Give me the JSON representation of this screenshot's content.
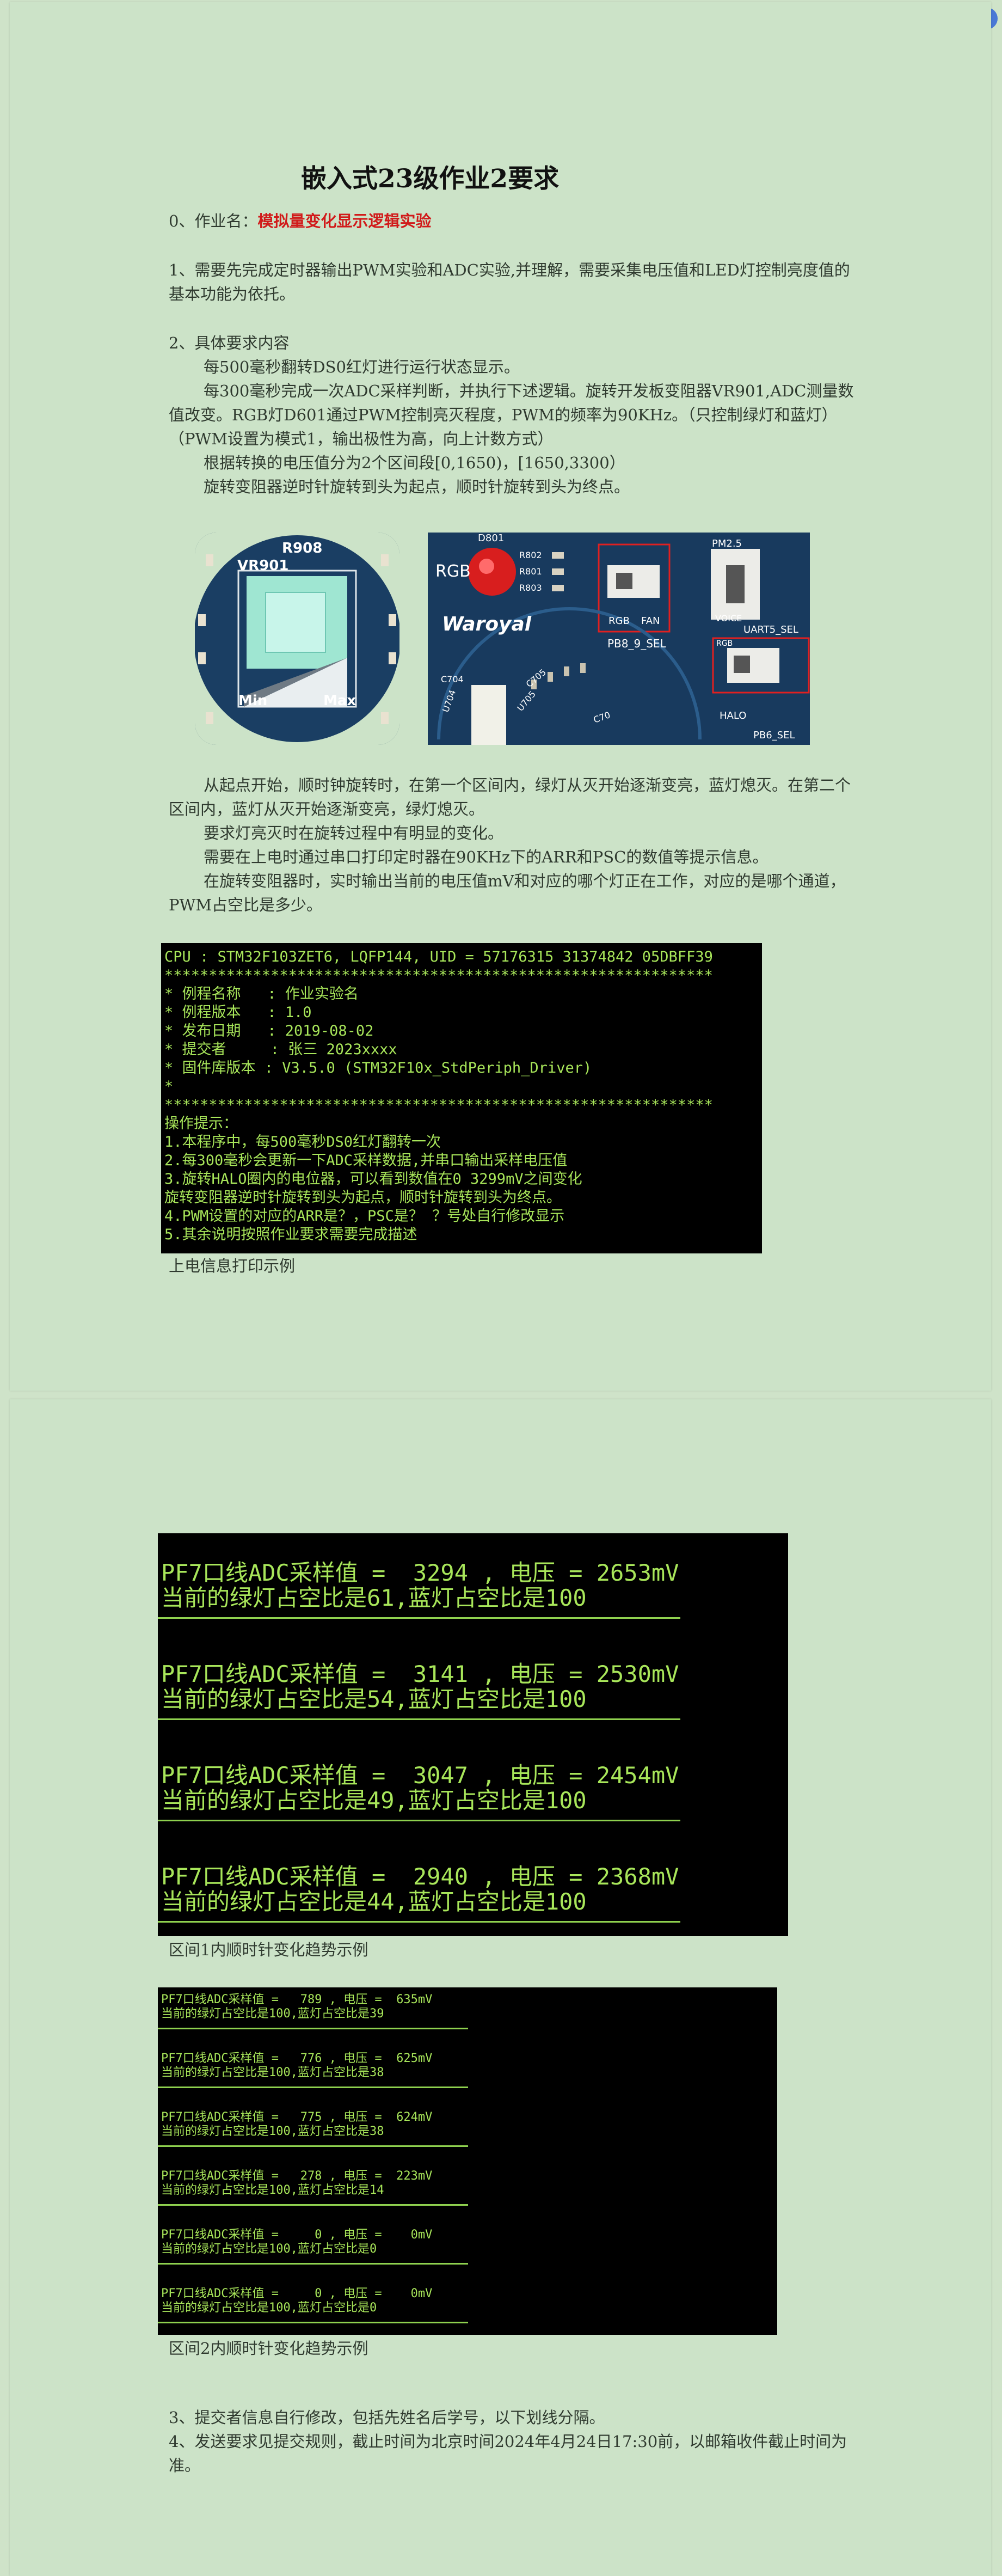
{
  "badge": "⚙",
  "title": "嵌入式23级作业2要求",
  "section0": {
    "prefix": "0、作业名：",
    "name": "模拟量变化显示逻辑实验"
  },
  "section1": "1、需要先完成定时器输出PWM实验和ADC实验,并理解，需要采集电压值和LED灯控制亮度值的基本功能为依托。",
  "section2": {
    "heading": "2、具体要求内容",
    "p1": "每500毫秒翻转DS0红灯进行运行状态显示。",
    "p2": "每300毫秒完成一次ADC采样判断，并执行下述逻辑。旋转开发板变阻器VR901,ADC测量数值改变。RGB灯D601通过PWM控制亮灭程度，PWM的频率为90KHz。（只控制绿灯和蓝灯）（PWM设置为模式1，输出极性为高，向上计数方式）",
    "p3": "根据转换的电压值分为2个区间段[0,1650)，[1650,3300）",
    "p4": "旋转变阻器逆时针旋转到头为起点，顺时针旋转到头为终点。",
    "p5": "从起点开始，顺时钟旋转时，在第一个区间内，绿灯从灭开始逐渐变亮，蓝灯熄灭。在第二个区间内，蓝灯从灭开始逐渐变亮，绿灯熄灭。",
    "p6": "要求灯亮灭时在旋转过程中有明显的变化。",
    "p7": "需要在上电时通过串口打印定时器在90KHz下的ARR和PSC的数值等提示信息。",
    "p8": "在旋转变阻器时，实时输出当前的电压值mV和对应的哪个灯正在工作，对应的是哪个通道，PWM占空比是多少。"
  },
  "board1": {
    "r": "R908",
    "vr": "VR901",
    "min": "Min",
    "max": "Max"
  },
  "board2": {
    "d801": "D801",
    "rgb": "RGB",
    "r802": "R802",
    "r801": "R801",
    "r803": "R803",
    "rgb2": "RGB",
    "fan": "FAN",
    "pb8": "PB8_9_SEL",
    "pm25": "PM2.5",
    "voice": "VOICE",
    "uart": "UART5_SEL",
    "rgb3": "RGB",
    "halo": "HALO",
    "pb6": "PB6_SEL",
    "brand": "Waroyal",
    "c704": "C704",
    "u704": "U704",
    "c705": "C705",
    "u705": "U705",
    "c70": "C70"
  },
  "boot_terminal": {
    "lines": [
      "CPU : STM32F103ZET6, LQFP144, UID = 57176315 31374842 05DBFF39",
      "**************************************************************",
      "* 例程名称   : 作业实验名",
      "* 例程版本   : 1.0",
      "* 发布日期   : 2019-08-02",
      "* 提交者     : 张三 2023xxxx",
      "* 固件库版本 : V3.5.0 (STM32F10x_StdPeriph_Driver)",
      "*",
      "**************************************************************",
      "操作提示：",
      "1.本程序中，每500毫秒DS0红灯翻转一次",
      "2.每300毫秒会更新一下ADC采样数据,并串口输出采样电压值",
      "3.旋转HALO圈内的电位器，可以看到数值在0 3299mV之间变化",
      "旋转变阻器逆时针旋转到头为起点，顺时针旋转到头为终点。",
      "4.PWM设置的对应的ARR是？，PSC是？ ？号处自行修改显示",
      "5.其余说明按照作业要求需要完成描述"
    ],
    "caption": "上电信息打印示例"
  },
  "range1_terminal": {
    "entries": [
      {
        "l1": "PF7口线ADC采样值 =  3294 , 电压 = 2653mV",
        "l2": "当前的绿灯占空比是61,蓝灯占空比是100"
      },
      {
        "l1": "PF7口线ADC采样值 =  3141 , 电压 = 2530mV",
        "l2": "当前的绿灯占空比是54,蓝灯占空比是100"
      },
      {
        "l1": "PF7口线ADC采样值 =  3047 , 电压 = 2454mV",
        "l2": "当前的绿灯占空比是49,蓝灯占空比是100"
      },
      {
        "l1": "PF7口线ADC采样值 =  2940 , 电压 = 2368mV",
        "l2": "当前的绿灯占空比是44,蓝灯占空比是100"
      }
    ],
    "caption": "区间1内顺时针变化趋势示例"
  },
  "range2_terminal": {
    "entries": [
      {
        "l1": "PF7口线ADC采样值 =   789 , 电压 =  635mV",
        "l2": "当前的绿灯占空比是100,蓝灯占空比是39"
      },
      {
        "l1": "PF7口线ADC采样值 =   776 , 电压 =  625mV",
        "l2": "当前的绿灯占空比是100,蓝灯占空比是38"
      },
      {
        "l1": "PF7口线ADC采样值 =   775 , 电压 =  624mV",
        "l2": "当前的绿灯占空比是100,蓝灯占空比是38"
      },
      {
        "l1": "PF7口线ADC采样值 =   278 , 电压 =  223mV",
        "l2": "当前的绿灯占空比是100,蓝灯占空比是14"
      },
      {
        "l1": "PF7口线ADC采样值 =     0 , 电压 =    0mV",
        "l2": "当前的绿灯占空比是100,蓝灯占空比是0"
      },
      {
        "l1": "PF7口线ADC采样值 =     0 , 电压 =    0mV",
        "l2": "当前的绿灯占空比是100,蓝灯占空比是0"
      }
    ],
    "caption": "区间2内顺时针变化趋势示例"
  },
  "section3": "3、提交者信息自行修改，包括先姓名后学号，以下划线分隔。",
  "section4": "4、发送要求见提交规则，截止时间为北京时间2024年4月24日17:30前，以邮箱收件截止时间为准。"
}
